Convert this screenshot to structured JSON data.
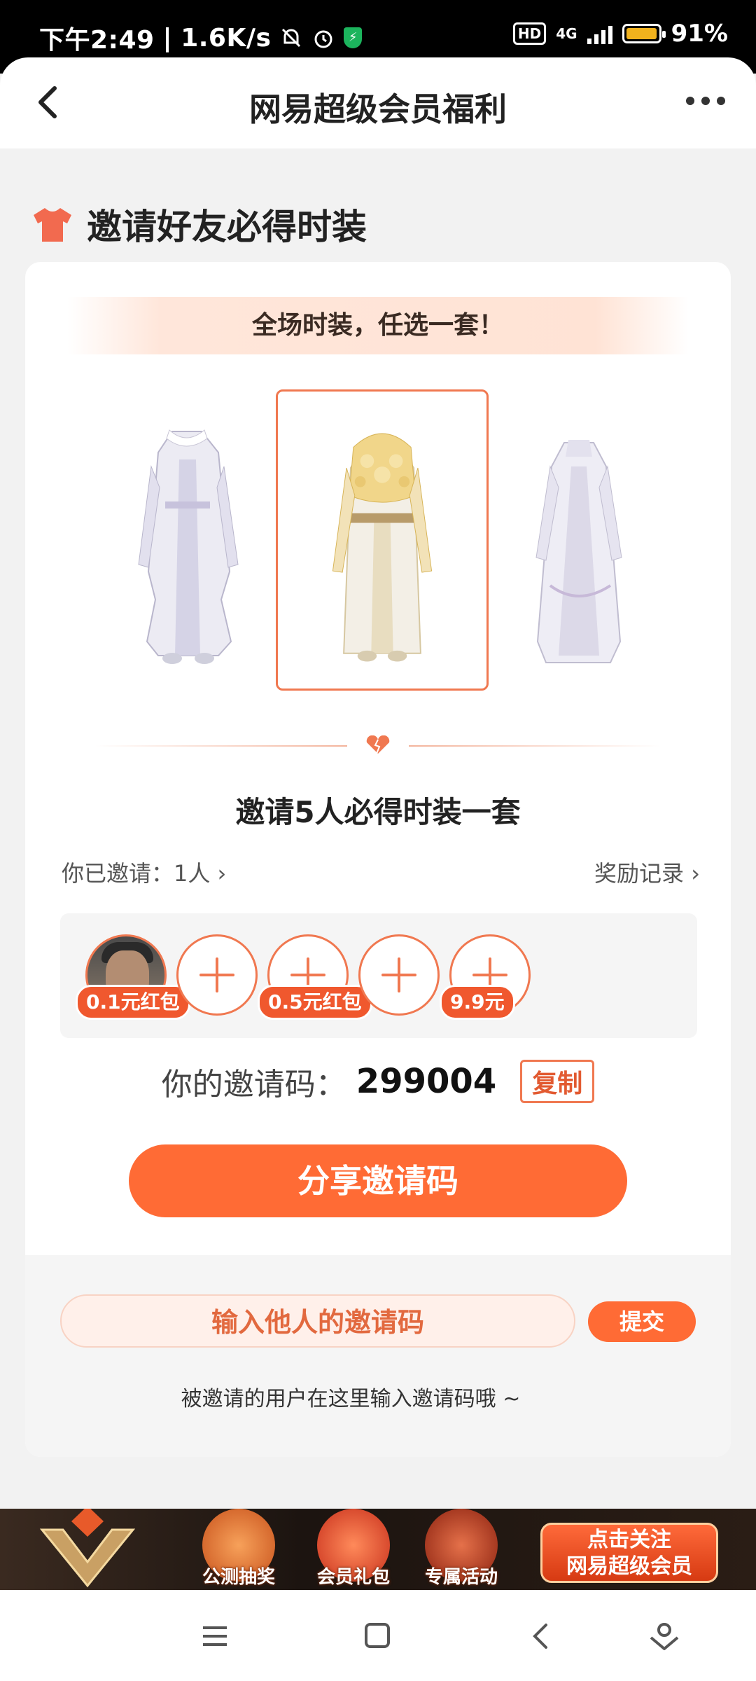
{
  "status_bar": {
    "time": "下午2:49",
    "speed": "1.6K/s",
    "network": "4G",
    "hd": "HD",
    "battery": "91%"
  },
  "nav": {
    "title": "网易超级会员福利"
  },
  "section": {
    "title": "邀请好友必得时装"
  },
  "card": {
    "banner": "全场时装，任选一套！",
    "goal": "邀请5人必得时装一套",
    "invited_count": "你已邀请：1人",
    "reward_log": "奖励记录",
    "slots": [
      {
        "state": "filled",
        "reward": "0.1元红包"
      },
      {
        "state": "empty"
      },
      {
        "state": "empty",
        "reward": "0.5元红包"
      },
      {
        "state": "empty"
      },
      {
        "state": "empty",
        "reward": "9.9元"
      }
    ],
    "code_label": "你的邀请码：",
    "code_value": "299004",
    "copy_label": "复制",
    "share_label": "分享邀请码"
  },
  "enter_code": {
    "placeholder": "输入他人的邀请码",
    "submit_label": "提交",
    "hint": "被邀请的用户在这里输入邀请码哦 ~"
  },
  "promo": {
    "items": [
      "公测抽奖",
      "会员礼包",
      "专属活动"
    ],
    "cta_line1": "点击关注",
    "cta_line2": "网易超级会员"
  },
  "colors": {
    "accent": "#ff6b35",
    "accent_border": "#f07850",
    "background": "#f2f2f2"
  }
}
